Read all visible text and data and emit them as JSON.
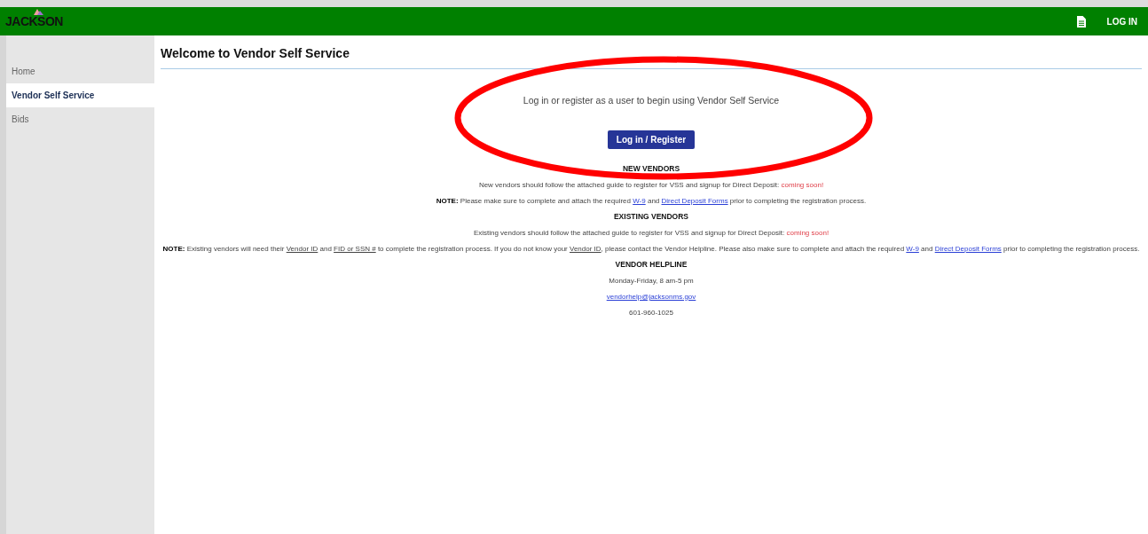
{
  "header": {
    "logo": "JACKSON",
    "login": "LOG IN"
  },
  "sidebar": {
    "items": [
      {
        "label": "Home",
        "selected": false
      },
      {
        "label": "Vendor Self Service",
        "selected": true
      },
      {
        "label": "Bids",
        "selected": false
      }
    ]
  },
  "main": {
    "title": "Welcome to Vendor Self Service",
    "intro": "Log in or register as a user to begin using Vendor Self Service",
    "button": "Log in / Register",
    "blocks": [
      {
        "kind": "heading",
        "parts": [
          {
            "kind": "text",
            "text": "NEW VENDORS"
          }
        ]
      },
      {
        "kind": "paragraph",
        "parts": [
          {
            "kind": "text",
            "text": "New vendors should follow the attached guide to register for VSS and signup for Direct Deposit: "
          },
          {
            "kind": "alert",
            "text": "coming soon!"
          }
        ]
      },
      {
        "kind": "paragraph",
        "parts": [
          {
            "kind": "bold",
            "text": "NOTE:"
          },
          {
            "kind": "text",
            "text": " Please make sure to complete and attach the required "
          },
          {
            "kind": "link",
            "text": "W-9"
          },
          {
            "kind": "text",
            "text": " and "
          },
          {
            "kind": "link",
            "text": "Direct Deposit Forms"
          },
          {
            "kind": "text",
            "text": " prior to completing the registration process."
          }
        ]
      },
      {
        "kind": "heading",
        "parts": [
          {
            "kind": "text",
            "text": "EXISTING VENDORS"
          }
        ]
      },
      {
        "kind": "paragraph",
        "parts": [
          {
            "kind": "text",
            "text": "Existing vendors should follow the attached guide to register for VSS and signup for Direct Deposit: "
          },
          {
            "kind": "alert",
            "text": "coming soon!"
          }
        ]
      },
      {
        "kind": "paragraph",
        "parts": [
          {
            "kind": "bold",
            "text": "NOTE:"
          },
          {
            "kind": "text",
            "text": " Existing vendors will need their "
          },
          {
            "kind": "underline",
            "text": "Vendor ID"
          },
          {
            "kind": "text",
            "text": " and "
          },
          {
            "kind": "underline",
            "text": "FID or SSN #"
          },
          {
            "kind": "text",
            "text": " to complete the registration process. If you do not know your "
          },
          {
            "kind": "underline",
            "text": "Vendor ID"
          },
          {
            "kind": "text",
            "text": ", please contact the Vendor Helpline. Please also make sure to complete and attach the required "
          },
          {
            "kind": "link",
            "text": "W-9"
          },
          {
            "kind": "text",
            "text": " and "
          },
          {
            "kind": "link",
            "text": "Direct Deposit Forms"
          },
          {
            "kind": "text",
            "text": " prior to completing the registration process."
          }
        ]
      },
      {
        "kind": "heading",
        "parts": [
          {
            "kind": "text",
            "text": "VENDOR HELPLINE"
          }
        ]
      },
      {
        "kind": "paragraph",
        "parts": [
          {
            "kind": "text",
            "text": "Monday-Friday, 8 am-5 pm"
          }
        ]
      },
      {
        "kind": "paragraph",
        "parts": [
          {
            "kind": "link",
            "text": "vendorhelp@jacksonms.gov"
          }
        ]
      },
      {
        "kind": "paragraph",
        "parts": [
          {
            "kind": "text",
            "text": "601-960-1025"
          }
        ]
      }
    ]
  }
}
